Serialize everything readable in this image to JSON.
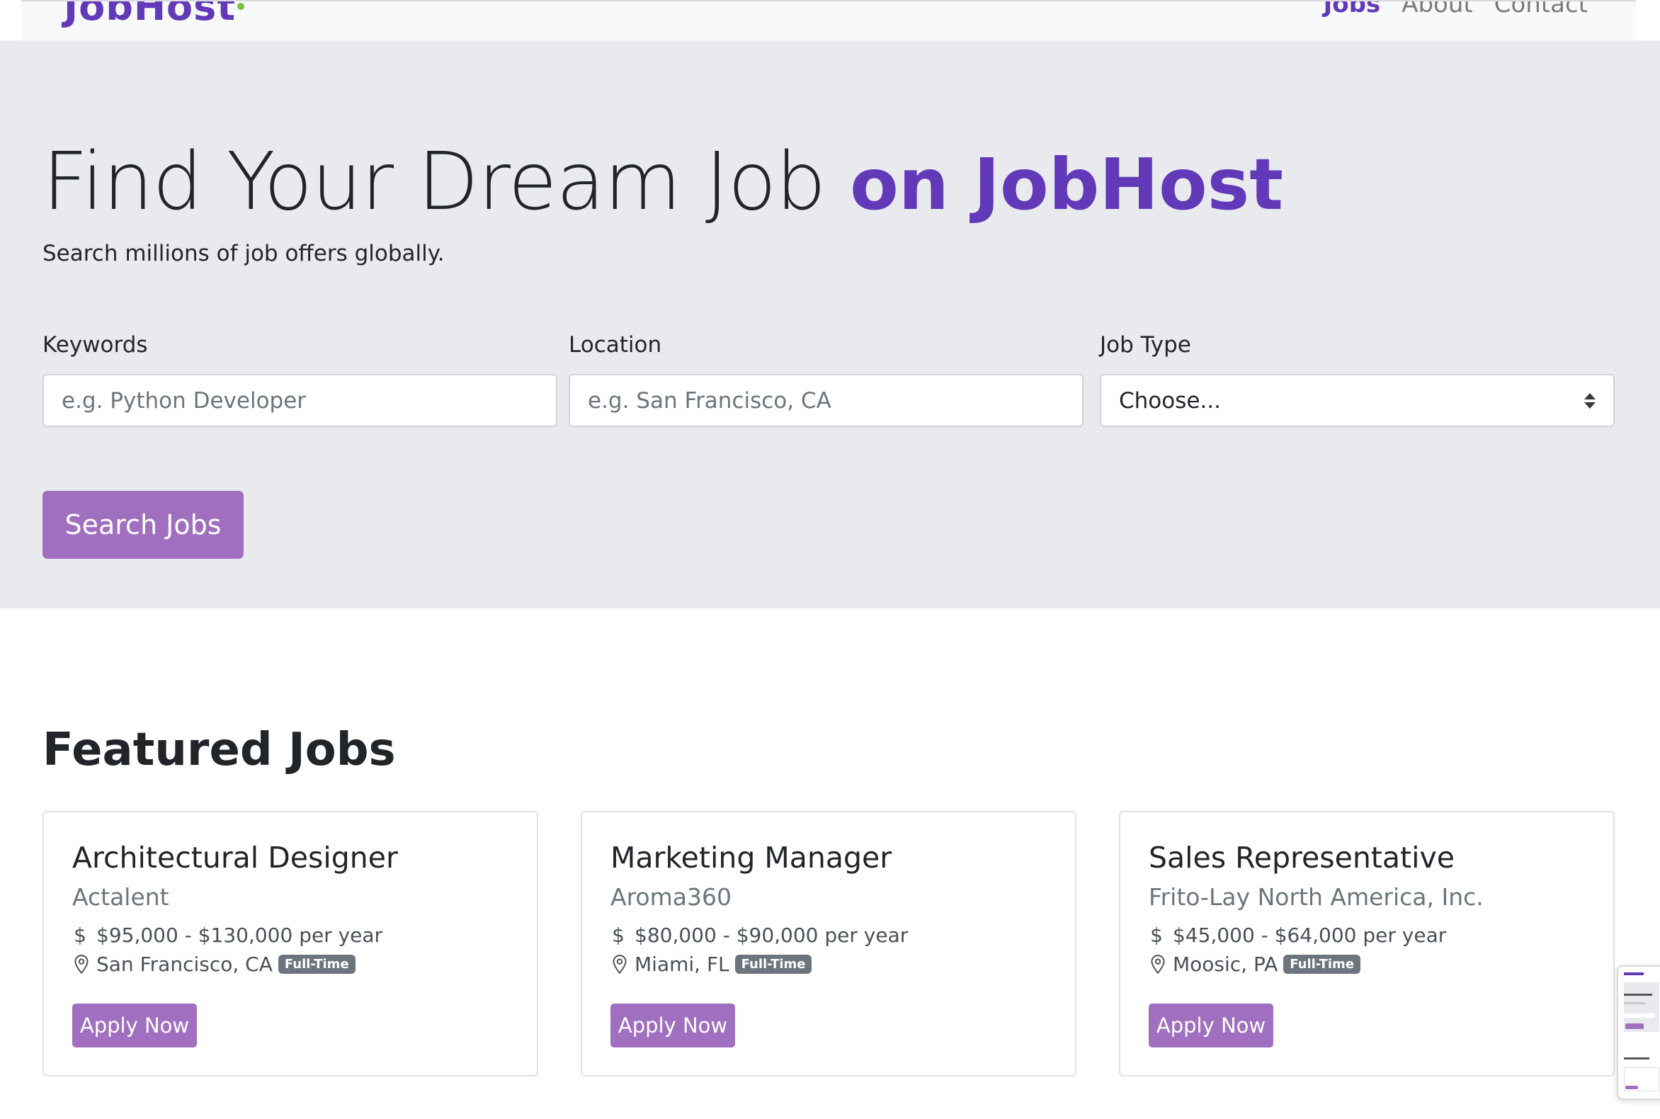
{
  "navbar": {
    "brand": "JobHost",
    "links": [
      {
        "label": "Jobs",
        "active": true
      },
      {
        "label": "About",
        "active": false
      },
      {
        "label": "Contact",
        "active": false
      }
    ]
  },
  "hero": {
    "title_main": "Find Your Dream Job",
    "title_accent": "on JobHost",
    "subtitle": "Search millions of job offers globally."
  },
  "search": {
    "keywords_label": "Keywords",
    "keywords_placeholder": "e.g. Python Developer",
    "location_label": "Location",
    "location_placeholder": "e.g. San Francisco, CA",
    "jobtype_label": "Job Type",
    "jobtype_selected": "Choose...",
    "button_label": "Search Jobs"
  },
  "featured": {
    "title": "Featured Jobs",
    "jobs": [
      {
        "title": "Architectural Designer",
        "company": "Actalent",
        "salary": "$95,000 - $130,000 per year",
        "location": "San Francisco, CA",
        "type": "Full-Time",
        "apply_label": "Apply Now"
      },
      {
        "title": "Marketing Manager",
        "company": "Aroma360",
        "salary": "$80,000 - $90,000 per year",
        "location": "Miami, FL",
        "type": "Full-Time",
        "apply_label": "Apply Now"
      },
      {
        "title": "Sales Representative",
        "company": "Frito-Lay North America, Inc.",
        "salary": "$45,000 - $64,000 per year",
        "location": "Moosic, PA",
        "type": "Full-Time",
        "apply_label": "Apply Now"
      }
    ]
  },
  "icons": {
    "salary": "dollar-icon",
    "location": "map-pin-icon"
  },
  "colors": {
    "brand": "#6239b8",
    "button": "#a06fbf",
    "hero_bg": "#e9eaee",
    "badge": "#6c757d"
  }
}
